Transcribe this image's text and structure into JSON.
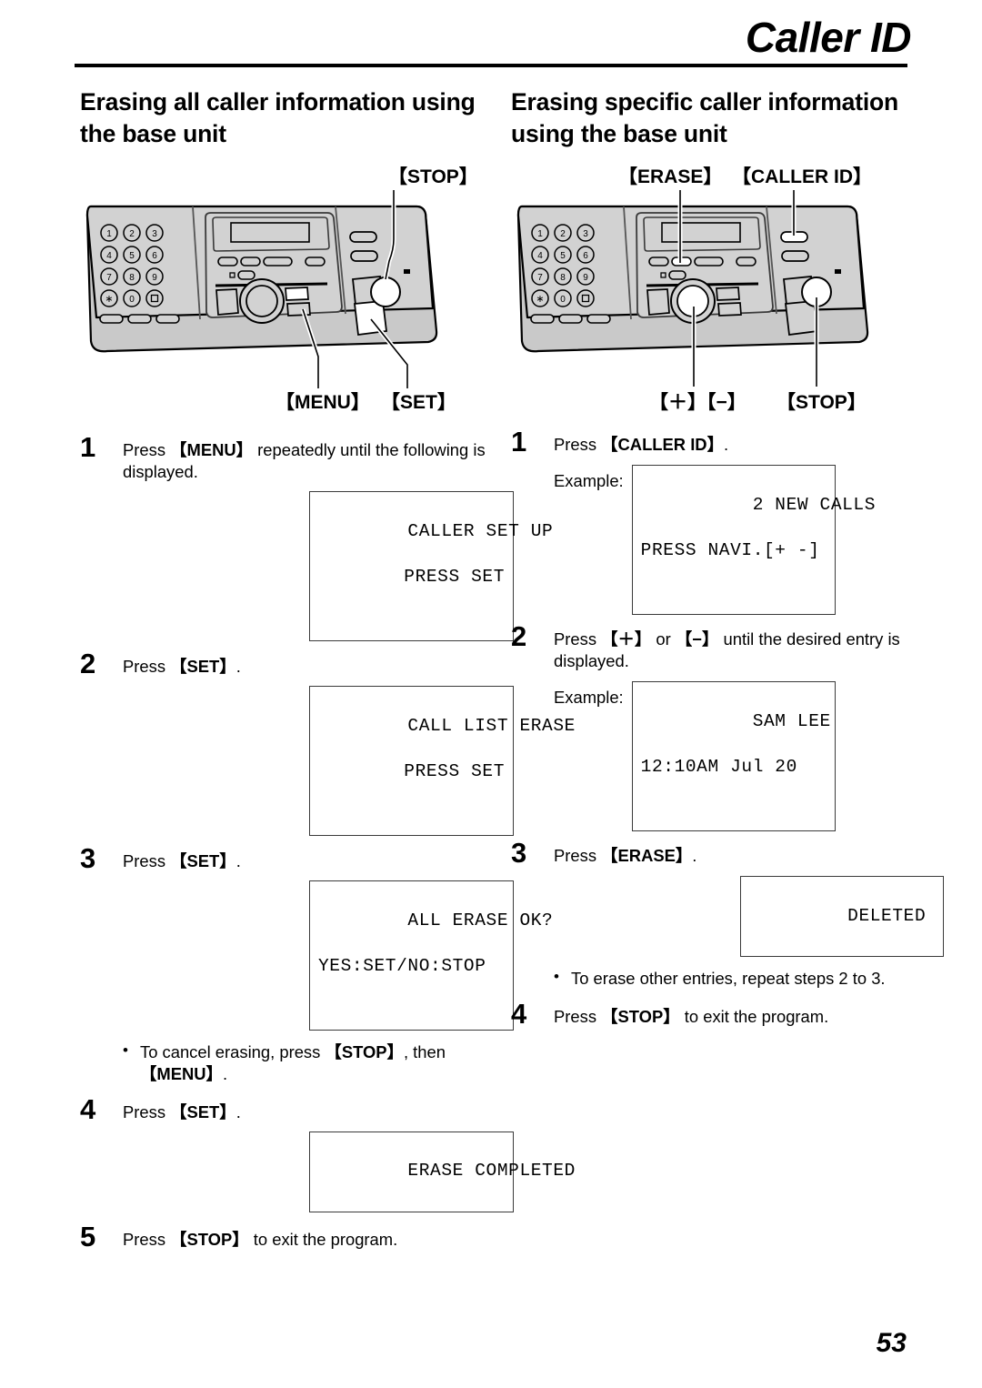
{
  "header": {
    "title": "Caller ID"
  },
  "left_column": {
    "heading": "Erasing all caller information using the base unit",
    "diagram": {
      "callout_stop": "【STOP】",
      "callout_menu": "【MENU】",
      "callout_set": "【SET】",
      "keypad": [
        "1",
        "2",
        "3",
        "4",
        "5",
        "6",
        "7",
        "8",
        "9",
        "∗",
        "0",
        "□"
      ]
    },
    "steps": [
      {
        "num": "1",
        "text_parts": [
          {
            "t": "Press ",
            "b": false
          },
          {
            "t": "【MENU】",
            "b": true
          },
          {
            "t": " repeatedly until the following is displayed.",
            "b": false
          }
        ],
        "lcd": {
          "line1": "CALLER SET UP",
          "line2": "PRESS SET",
          "align2": "right"
        }
      },
      {
        "num": "2",
        "text_parts": [
          {
            "t": "Press ",
            "b": false
          },
          {
            "t": "【SET】",
            "b": true
          },
          {
            "t": ".",
            "b": false
          }
        ],
        "lcd": {
          "line1": "CALL LIST ERASE",
          "line2": "PRESS SET",
          "align2": "right"
        }
      },
      {
        "num": "3",
        "text_parts": [
          {
            "t": "Press ",
            "b": false
          },
          {
            "t": "【SET】",
            "b": true
          },
          {
            "t": ".",
            "b": false
          }
        ],
        "lcd": {
          "line1": "ALL ERASE OK?",
          "line2": "YES:SET/NO:STOP",
          "align2": "left"
        },
        "bullet_parts": [
          {
            "t": "To cancel erasing, press ",
            "b": false
          },
          {
            "t": "【STOP】",
            "b": true
          },
          {
            "t": ", then ",
            "b": false
          },
          {
            "t": "【MENU】",
            "b": true
          },
          {
            "t": ".",
            "b": false
          }
        ]
      },
      {
        "num": "4",
        "text_parts": [
          {
            "t": "Press ",
            "b": false
          },
          {
            "t": "【SET】",
            "b": true
          },
          {
            "t": ".",
            "b": false
          }
        ],
        "lcd": {
          "line1": "ERASE COMPLETED",
          "line2": "",
          "align2": "left"
        }
      },
      {
        "num": "5",
        "text_parts": [
          {
            "t": "Press ",
            "b": false
          },
          {
            "t": "【STOP】",
            "b": true
          },
          {
            "t": " to exit the program.",
            "b": false
          }
        ]
      }
    ]
  },
  "right_column": {
    "heading": "Erasing specific caller information using the base unit",
    "diagram": {
      "callout_erase": "【ERASE】",
      "callout_caller_id": "【CALLER ID】",
      "callout_plus_minus": "【＋】【−】",
      "callout_stop": "【STOP】",
      "keypad": [
        "1",
        "2",
        "3",
        "4",
        "5",
        "6",
        "7",
        "8",
        "9",
        "∗",
        "0",
        "□"
      ]
    },
    "example_label": "Example:",
    "steps": [
      {
        "num": "1",
        "text_parts": [
          {
            "t": "Press ",
            "b": false
          },
          {
            "t": "【CALLER ID】",
            "b": true
          },
          {
            "t": ".",
            "b": false
          }
        ],
        "lcd": {
          "line1": "2 NEW CALLS",
          "line2": "PRESS NAVI.[+ -]",
          "align2": "left"
        },
        "has_example": true
      },
      {
        "num": "2",
        "text_parts": [
          {
            "t": "Press ",
            "b": false
          },
          {
            "t": "【＋】",
            "b": true
          },
          {
            "t": " or ",
            "b": false
          },
          {
            "t": "【−】",
            "b": true
          },
          {
            "t": " until the desired entry is displayed.",
            "b": false
          }
        ],
        "lcd": {
          "line1": "SAM LEE",
          "line2": "12:10AM Jul 20",
          "align2": "left"
        },
        "has_example": true
      },
      {
        "num": "3",
        "text_parts": [
          {
            "t": "Press ",
            "b": false
          },
          {
            "t": "【ERASE】",
            "b": true
          },
          {
            "t": ".",
            "b": false
          }
        ],
        "lcd": {
          "line1": "DELETED",
          "line2": "",
          "align1": "center"
        },
        "bullet_parts": [
          {
            "t": "To erase other entries, repeat steps 2 to 3.",
            "b": false
          }
        ]
      },
      {
        "num": "4",
        "text_parts": [
          {
            "t": "Press ",
            "b": false
          },
          {
            "t": "【STOP】",
            "b": true
          },
          {
            "t": " to exit the program.",
            "b": false
          }
        ]
      }
    ]
  },
  "footer": {
    "page_number": "53"
  },
  "colors": {
    "body_gray": "#c9c9c9",
    "panel_gray": "#d6d6d6",
    "outline": "#000000",
    "highlight": "#ffffff",
    "lcd_border": "#3a3a3a"
  }
}
